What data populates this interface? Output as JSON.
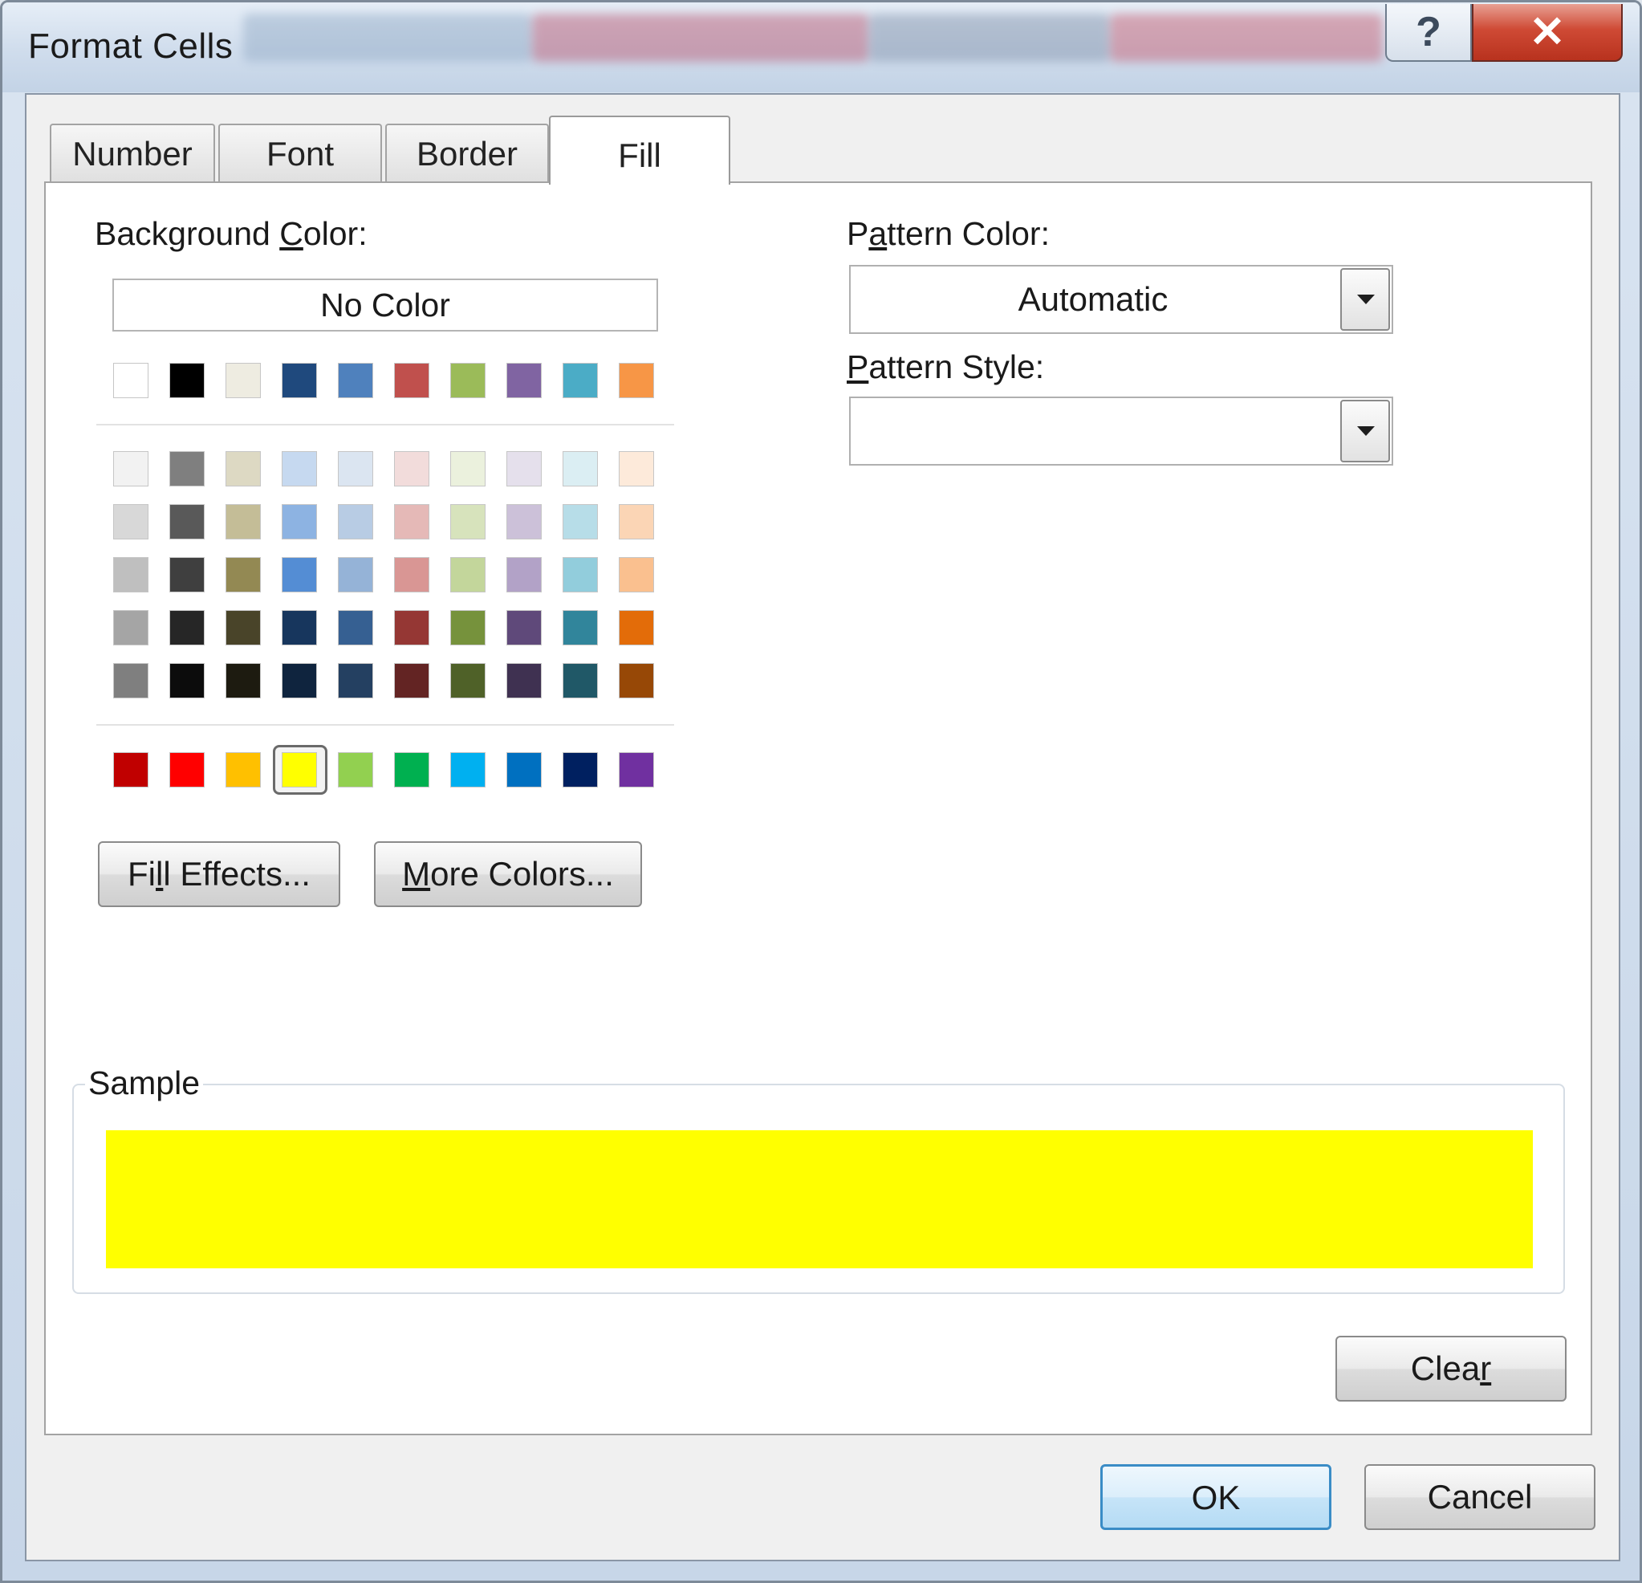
{
  "window": {
    "title": "Format Cells",
    "help_glyph": "?",
    "close_glyph": "✕"
  },
  "tabs": [
    {
      "label": "Number",
      "active": false
    },
    {
      "label": "Font",
      "active": false
    },
    {
      "label": "Border",
      "active": false
    },
    {
      "label": "Fill",
      "active": true
    }
  ],
  "fill": {
    "background_label_pre": "Background ",
    "background_label_key": "C",
    "background_label_post": "olor:",
    "no_color_label": "No Color",
    "theme_row": [
      "#ffffff",
      "#000000",
      "#eeece1",
      "#1f497d",
      "#4f81bd",
      "#c0504d",
      "#9bbb59",
      "#8064a2",
      "#4bacc6",
      "#f79646"
    ],
    "tint_rows": [
      [
        "#f2f2f2",
        "#7f7f7f",
        "#ddd9c3",
        "#c6d9f0",
        "#dbe5f1",
        "#f2dcdb",
        "#ebf1dd",
        "#e5e0ec",
        "#dbeef3",
        "#fdeada"
      ],
      [
        "#d8d8d8",
        "#595959",
        "#c4bd97",
        "#8db3e2",
        "#b8cce4",
        "#e5b9b7",
        "#d7e3bc",
        "#ccc1d9",
        "#b7dde8",
        "#fbd5b5"
      ],
      [
        "#bfbfbf",
        "#3f3f3f",
        "#938953",
        "#548dd4",
        "#95b3d7",
        "#d99694",
        "#c3d69b",
        "#b2a2c7",
        "#92cddc",
        "#fac08f"
      ],
      [
        "#a5a5a5",
        "#262626",
        "#494429",
        "#17365d",
        "#366092",
        "#953734",
        "#76923c",
        "#5f497a",
        "#31859b",
        "#e36c09"
      ],
      [
        "#7f7f7f",
        "#0c0c0c",
        "#1d1b10",
        "#0f243e",
        "#244061",
        "#632423",
        "#4f6128",
        "#3f3151",
        "#205867",
        "#974806"
      ]
    ],
    "standard_row": [
      "#c00000",
      "#ff0000",
      "#ffc000",
      "#ffff00",
      "#92d050",
      "#00b050",
      "#00b0f0",
      "#0070c0",
      "#002060",
      "#7030a0"
    ],
    "selected_color_name": "Yellow",
    "selected_color": "#ffff00",
    "fill_effects_pre": "Fi",
    "fill_effects_key": "l",
    "fill_effects_post": "l Effects...",
    "more_colors_pre": "",
    "more_colors_key": "M",
    "more_colors_post": "ore Colors...",
    "pattern_color_pre": "P",
    "pattern_color_key": "a",
    "pattern_color_post": "ttern Color:",
    "pattern_color_value": "Automatic",
    "pattern_style_pre": "",
    "pattern_style_key": "P",
    "pattern_style_post": "attern Style:",
    "pattern_style_value": "",
    "sample_label": "Sample",
    "clear_pre": "Clea",
    "clear_key": "r",
    "clear_post": ""
  },
  "footer": {
    "ok_label": "OK",
    "cancel_label": "Cancel"
  }
}
